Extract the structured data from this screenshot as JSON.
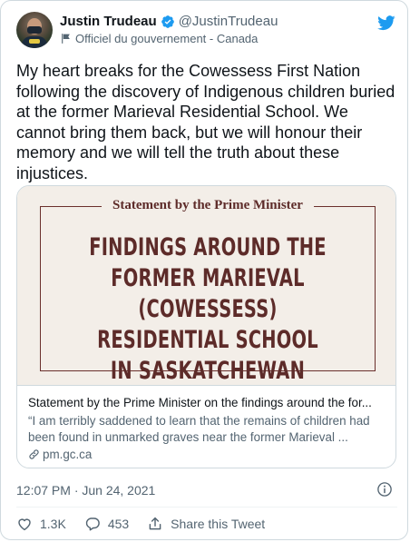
{
  "author": {
    "name": "Justin Trudeau",
    "handle": "@JustinTrudeau",
    "label": "Officiel du gouvernement - Canada"
  },
  "tweet": {
    "text": "My heart breaks for the Cowessess First Nation following the discovery of Indigenous children buried at the former Marieval Residential School. We cannot bring them back, but we will honour their memory and we will tell the truth about these injustices."
  },
  "link_card": {
    "image_label": "Statement by the Prime Minister",
    "image_headline": "FINDINGS AROUND THE FORMER MARIEVAL (COWESSESS) RESIDENTIAL SCHOOL IN SASKATCHEWAN",
    "title": "Statement by the Prime Minister on the findings around the for...",
    "description": "“I am terribly saddened to learn that the remains of children had been found in unmarked graves near the former Marieval ...",
    "domain": "pm.gc.ca"
  },
  "meta": {
    "timestamp": "12:07 PM · Jun 24, 2021"
  },
  "actions": {
    "likes": "1.3K",
    "replies": "453",
    "share_label": "Share this Tweet"
  },
  "colors": {
    "verified_blue": "#1d9bf0",
    "headline_maroon": "#5d2b29",
    "muted_text": "#536471"
  },
  "icons": [
    "verified-badge-icon",
    "government-flag-icon",
    "twitter-bird-icon",
    "link-icon",
    "info-icon",
    "heart-icon",
    "reply-icon",
    "share-icon"
  ]
}
